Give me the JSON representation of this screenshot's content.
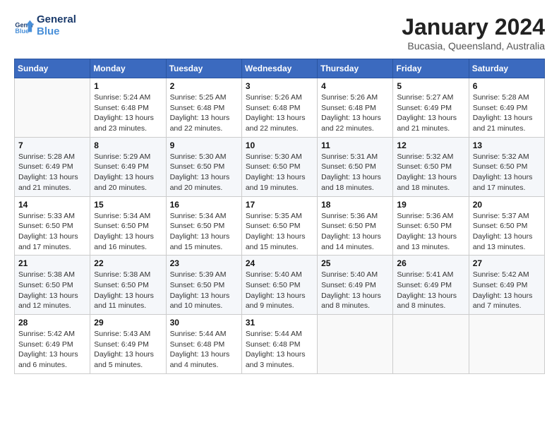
{
  "header": {
    "logo_line1": "General",
    "logo_line2": "Blue",
    "month": "January 2024",
    "location": "Bucasia, Queensland, Australia"
  },
  "weekdays": [
    "Sunday",
    "Monday",
    "Tuesday",
    "Wednesday",
    "Thursday",
    "Friday",
    "Saturday"
  ],
  "weeks": [
    [
      {
        "day": "",
        "empty": true
      },
      {
        "day": "1",
        "sunrise": "5:24 AM",
        "sunset": "6:48 PM",
        "daylight": "13 hours and 23 minutes."
      },
      {
        "day": "2",
        "sunrise": "5:25 AM",
        "sunset": "6:48 PM",
        "daylight": "13 hours and 22 minutes."
      },
      {
        "day": "3",
        "sunrise": "5:26 AM",
        "sunset": "6:48 PM",
        "daylight": "13 hours and 22 minutes."
      },
      {
        "day": "4",
        "sunrise": "5:26 AM",
        "sunset": "6:48 PM",
        "daylight": "13 hours and 22 minutes."
      },
      {
        "day": "5",
        "sunrise": "5:27 AM",
        "sunset": "6:49 PM",
        "daylight": "13 hours and 21 minutes."
      },
      {
        "day": "6",
        "sunrise": "5:28 AM",
        "sunset": "6:49 PM",
        "daylight": "13 hours and 21 minutes."
      }
    ],
    [
      {
        "day": "7",
        "sunrise": "5:28 AM",
        "sunset": "6:49 PM",
        "daylight": "13 hours and 21 minutes."
      },
      {
        "day": "8",
        "sunrise": "5:29 AM",
        "sunset": "6:49 PM",
        "daylight": "13 hours and 20 minutes."
      },
      {
        "day": "9",
        "sunrise": "5:30 AM",
        "sunset": "6:50 PM",
        "daylight": "13 hours and 20 minutes."
      },
      {
        "day": "10",
        "sunrise": "5:30 AM",
        "sunset": "6:50 PM",
        "daylight": "13 hours and 19 minutes."
      },
      {
        "day": "11",
        "sunrise": "5:31 AM",
        "sunset": "6:50 PM",
        "daylight": "13 hours and 18 minutes."
      },
      {
        "day": "12",
        "sunrise": "5:32 AM",
        "sunset": "6:50 PM",
        "daylight": "13 hours and 18 minutes."
      },
      {
        "day": "13",
        "sunrise": "5:32 AM",
        "sunset": "6:50 PM",
        "daylight": "13 hours and 17 minutes."
      }
    ],
    [
      {
        "day": "14",
        "sunrise": "5:33 AM",
        "sunset": "6:50 PM",
        "daylight": "13 hours and 17 minutes."
      },
      {
        "day": "15",
        "sunrise": "5:34 AM",
        "sunset": "6:50 PM",
        "daylight": "13 hours and 16 minutes."
      },
      {
        "day": "16",
        "sunrise": "5:34 AM",
        "sunset": "6:50 PM",
        "daylight": "13 hours and 15 minutes."
      },
      {
        "day": "17",
        "sunrise": "5:35 AM",
        "sunset": "6:50 PM",
        "daylight": "13 hours and 15 minutes."
      },
      {
        "day": "18",
        "sunrise": "5:36 AM",
        "sunset": "6:50 PM",
        "daylight": "13 hours and 14 minutes."
      },
      {
        "day": "19",
        "sunrise": "5:36 AM",
        "sunset": "6:50 PM",
        "daylight": "13 hours and 13 minutes."
      },
      {
        "day": "20",
        "sunrise": "5:37 AM",
        "sunset": "6:50 PM",
        "daylight": "13 hours and 13 minutes."
      }
    ],
    [
      {
        "day": "21",
        "sunrise": "5:38 AM",
        "sunset": "6:50 PM",
        "daylight": "13 hours and 12 minutes."
      },
      {
        "day": "22",
        "sunrise": "5:38 AM",
        "sunset": "6:50 PM",
        "daylight": "13 hours and 11 minutes."
      },
      {
        "day": "23",
        "sunrise": "5:39 AM",
        "sunset": "6:50 PM",
        "daylight": "13 hours and 10 minutes."
      },
      {
        "day": "24",
        "sunrise": "5:40 AM",
        "sunset": "6:50 PM",
        "daylight": "13 hours and 9 minutes."
      },
      {
        "day": "25",
        "sunrise": "5:40 AM",
        "sunset": "6:49 PM",
        "daylight": "13 hours and 8 minutes."
      },
      {
        "day": "26",
        "sunrise": "5:41 AM",
        "sunset": "6:49 PM",
        "daylight": "13 hours and 8 minutes."
      },
      {
        "day": "27",
        "sunrise": "5:42 AM",
        "sunset": "6:49 PM",
        "daylight": "13 hours and 7 minutes."
      }
    ],
    [
      {
        "day": "28",
        "sunrise": "5:42 AM",
        "sunset": "6:49 PM",
        "daylight": "13 hours and 6 minutes."
      },
      {
        "day": "29",
        "sunrise": "5:43 AM",
        "sunset": "6:49 PM",
        "daylight": "13 hours and 5 minutes."
      },
      {
        "day": "30",
        "sunrise": "5:44 AM",
        "sunset": "6:48 PM",
        "daylight": "13 hours and 4 minutes."
      },
      {
        "day": "31",
        "sunrise": "5:44 AM",
        "sunset": "6:48 PM",
        "daylight": "13 hours and 3 minutes."
      },
      {
        "day": "",
        "empty": true
      },
      {
        "day": "",
        "empty": true
      },
      {
        "day": "",
        "empty": true
      }
    ]
  ]
}
